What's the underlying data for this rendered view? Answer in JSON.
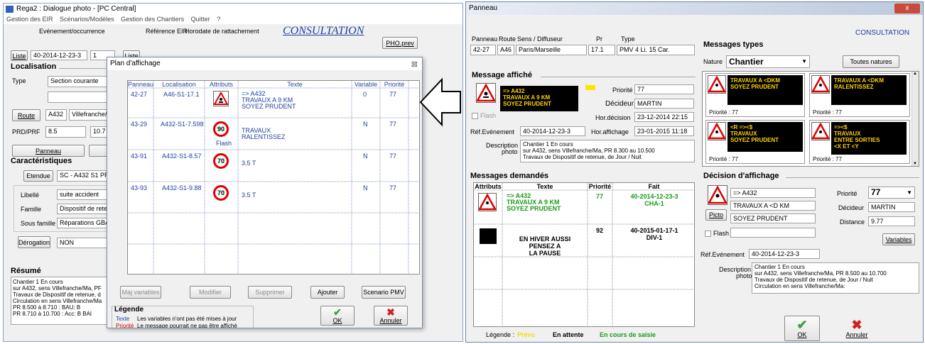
{
  "left": {
    "title": "Rega2 : Dialogue photo - [PC Central]",
    "menu": [
      "Gestion des EIR",
      "Scénarios/Modèles",
      "Gestion des Chantiers",
      "Quitter",
      "?"
    ],
    "evt_label": "Evénement/occurrence",
    "ref_label": "Référence EIR",
    "horodate_label": "Horodate de rattachement",
    "consultation": "CONSULTATION",
    "pho_btn": "PHO.prev",
    "liste_btn": "Liste",
    "liste_btn2": "Liste",
    "evt_value": "40-2014-12-23-3",
    "evt_num": "1",
    "localisation": "Localisation",
    "type_label": "Type",
    "type_value": "Section courante",
    "route_btn": "Route",
    "route_value": "A432",
    "route_dir": "Villefranche/M",
    "prd_label": "PRD/PRF",
    "prd_value": "8.5",
    "prf_value": "10.7",
    "panneau_btn": "Panneau",
    "caract": "Caractéristiques",
    "etendue_btn": "Etendue",
    "etendue_value": "SC - A432 S1 PR 8",
    "libelle_label": "Libellé",
    "libelle_value": "suite accident",
    "famille_label": "Famille",
    "famille_value": "Dispositif de retenu",
    "sousfam_label": "Sous famille",
    "sousfam_value": "Réparations GBA",
    "derog_btn": "Dérogation",
    "derog_value": "NON",
    "resume": "Résumé",
    "resume_lines": [
      "Chantier 1 En cours",
      "sur A432, sens Villefranche/Ma, PF",
      "Travaux de Dispositif de retenue, d",
      "Circulation en sens Villefranche/Ma",
      "  PR 8.500 à 8.710 :  BAU: B",
      "  PR 8.710 à 10.700 :  Acc: B  BAl"
    ]
  },
  "plan": {
    "title": "Plan d'affichage",
    "headers": [
      "Panneau",
      "Localisation",
      "Attributs",
      "Texte",
      "Variable",
      "Priorité"
    ],
    "rows": [
      {
        "panneau": "42-27",
        "loc": "A46-S1-17.1",
        "attr": "warning",
        "flash": "",
        "t1": "=> A432",
        "t2": "TRAVAUX A 9 KM",
        "t3": "SOYEZ PRUDENT",
        "var": "0",
        "prio": "77"
      },
      {
        "panneau": "43-29",
        "loc": "A432-S1-7.598",
        "attr": "90",
        "flash": "Flash",
        "t1": "TRAVAUX",
        "t2": "RALENTISSEZ",
        "t3": "",
        "var": "N",
        "prio": "77"
      },
      {
        "panneau": "43-91",
        "loc": "A432-S1-8.57",
        "attr": "70",
        "flash": "",
        "t1": "3.5 T",
        "t2": "",
        "t3": "",
        "var": "N",
        "prio": "77"
      },
      {
        "panneau": "43-93",
        "loc": "A432-S1-9.88",
        "attr": "70",
        "flash": "",
        "t1": "3.5 T",
        "t2": "",
        "t3": "",
        "var": "N",
        "prio": "77"
      }
    ],
    "btn_maj": "Maj variables",
    "btn_modifier": "Modifier",
    "btn_supprimer": "Supprimer",
    "btn_ajouter": "Ajouter",
    "btn_scenario": "Scenario PMV",
    "legende": "Légende",
    "leg1_key": "Texte",
    "leg1_text": "Les variables n'ont pas été mises à jour",
    "leg2_key": "Priorité",
    "leg2_text": "Le message pourrait ne pas être affiché",
    "ok": "OK",
    "annuler": "Annuler",
    "close": "⊠"
  },
  "right": {
    "title": "Panneau",
    "consultation": "CONSULTATION",
    "h_panneau": "Panneau",
    "h_route": "Route",
    "h_sens": "Sens / Diffuseur",
    "h_pr": "Pr",
    "h_type": "Type",
    "v_panneau": "42-27",
    "v_route": "A46",
    "v_sens": "Paris/Marseille",
    "v_pr": "17.1",
    "v_type": "PMV  4 Li. 15 Car.",
    "msg_affiche": "Message affiché",
    "sign_lines": [
      "=> A432",
      "TRAVAUX A 9 KM",
      "SOYEZ PRUDENT"
    ],
    "flash": "Flash",
    "priorite_label": "Priorité",
    "priorite_value": "77",
    "decideur_label": "Décideur",
    "decideur_value": "MARTIN",
    "hor_dec_label": "Hor.décision",
    "hor_dec_value": "23-12-2014 22:15",
    "ref_evt_label": "Réf.Evénement",
    "ref_evt_value": "40-2014-12-23-3",
    "hor_aff_label": "Hor.affichage",
    "hor_aff_value": "23-01-2015 11:18",
    "desc_label": "Description",
    "photo_label": "photo",
    "desc_lines": [
      "Chantier 1 En cours",
      "sur A432, sens Villefranche/Ma, PR 8.300 au 10.500",
      "Travaux de Dispositif de retenue, de Jour / Nuit"
    ],
    "msgs_types": "Messages types",
    "nature_label": "Nature",
    "nature_value": "Chantier",
    "toutes": "Toutes natures",
    "types": [
      {
        "l1": "TRAVAUX A <DKM",
        "l2": "SOYEZ PRUDENT",
        "l3": "",
        "prio": "Priorité : 77"
      },
      {
        "l1": "TRAVAUX A <DKM",
        "l2": "RALENTISSEZ",
        "l3": "",
        "prio": "Priorité : 77"
      },
      {
        "l1": "<R =><$",
        "l2": "TRAVAUX",
        "l3": "SOYEZ PRUDENT",
        "prio": "Priorité : 77"
      },
      {
        "l1": "=><$",
        "l2": "TRAVAUX",
        "l3": "ENTRE SORTIES",
        "l4": "<X ET <Y",
        "prio": "Priorité : 77"
      }
    ],
    "msgs_dem": "Messages demandés",
    "dh": [
      "Attributs",
      "Texte",
      "Priorité",
      "Fait"
    ],
    "drows": [
      {
        "t1": "=> A432",
        "t2": "TRAVAUX A 9 KM",
        "t3": "SOYEZ PRUDENT",
        "prio": "77",
        "f1": "40-2014-12-23-3",
        "f2": "CHA-1"
      },
      {
        "t1": "EN HIVER AUSSI",
        "t2": "PENSEZ A",
        "t3": "LA PAUSE",
        "prio": "92",
        "f1": "40-2015-01-17-1",
        "f2": "DIV-1"
      }
    ],
    "decision": "Décision d'affichage",
    "d_l1": "=> A432",
    "d_l2": "TRAVAUX A <D KM",
    "d_l3": "SOYEZ PRUDENT",
    "picto": "Picto",
    "d_flash": "Flash",
    "d_prio_label": "Priorité",
    "d_prio_value": "77",
    "d_dec_label": "Décideur",
    "d_dec_value": "MARTIN",
    "d_dist_label": "Distance",
    "d_dist_value": "9.77",
    "variables_btn": "Variables",
    "d_ref_label": "Réf.Evénement",
    "d_ref_value": "40-2014-12-23-3",
    "d_desc_lines": [
      "Chantier 1 En cours",
      "sur A432, sens Villefranche/Ma, PR 8.500 au 10.700",
      "Travaux de Dispositif de retenue, de Jour / Nuit",
      "Circulation en sens Villefranche/Ma:"
    ],
    "legende": "Légende :",
    "leg_prevu": "Prévu",
    "leg_attente": "En attente",
    "leg_saisie": "En cours de saisie",
    "ok": "OK",
    "annuler": "Annuler",
    "close": "x"
  },
  "colors": {
    "accent": "#1f3fa0",
    "sign_bg": "#000000",
    "sign_text": "#ffd400",
    "green": "#1c9a1c",
    "red": "#d00000"
  }
}
